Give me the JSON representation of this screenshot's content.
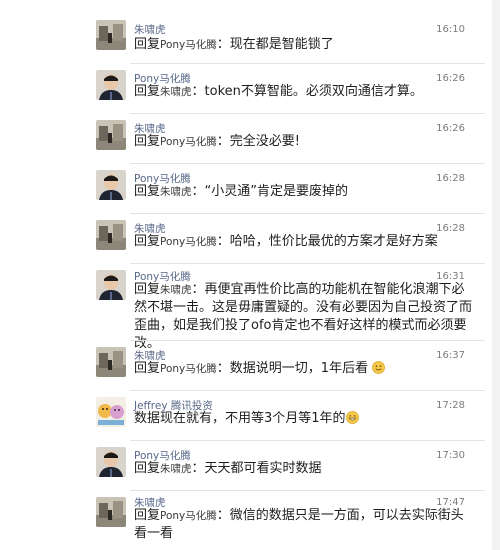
{
  "comments": [
    {
      "author": "朱啸虎",
      "time": "16:10",
      "reply_word": "回复",
      "reply_to": "Pony马化腾",
      "sep": "：",
      "text": "现在都是智能锁了",
      "avatar": "street-photo"
    },
    {
      "author": "Pony马化腾",
      "time": "16:26",
      "reply_word": "回复",
      "reply_to": "朱啸虎",
      "sep": "：",
      "text": "token不算智能。必须双向通信才算。",
      "avatar": "portrait-photo"
    },
    {
      "author": "朱啸虎",
      "time": "16:26",
      "reply_word": "回复",
      "reply_to": "Pony马化腾",
      "sep": "：",
      "text": "完全没必要!",
      "avatar": "street-photo"
    },
    {
      "author": "Pony马化腾",
      "time": "16:28",
      "reply_word": "回复",
      "reply_to": "朱啸虎",
      "sep": "：",
      "text": "“小灵通”肯定是要废掉的",
      "avatar": "portrait-photo"
    },
    {
      "author": "朱啸虎",
      "time": "16:28",
      "reply_word": "回复",
      "reply_to": "Pony马化腾",
      "sep": "：",
      "text": "哈哈，性价比最优的方案才是好方案",
      "avatar": "street-photo"
    },
    {
      "author": "Pony马化腾",
      "time": "16:31",
      "reply_word": "回复",
      "reply_to": "朱啸虎",
      "sep": "：",
      "text": "再便宜再性价比高的功能机在智能化浪潮下必然不堪一击。这是毋庸置疑的。没有必要因为自己投资了而歪曲，如是我们投了ofo肯定也不看好这样的模式而必须要改。",
      "avatar": "portrait-photo"
    },
    {
      "author": "朱啸虎",
      "time": "16:37",
      "reply_word": "回复",
      "reply_to": "Pony马化腾",
      "sep": "：",
      "text": "数据说明一切，1年后看",
      "emoji": "smile-emoji",
      "avatar": "street-photo"
    },
    {
      "author": "Jeffrey 腾讯投资",
      "time": "17:28",
      "reply_word": "",
      "reply_to": "",
      "sep": "",
      "text": "数据现在就有，不用等3个月等1年的",
      "emoji": "grin-emoji",
      "avatar": "cartoon-photo"
    },
    {
      "author": "Pony马化腾",
      "time": "17:30",
      "reply_word": "回复",
      "reply_to": "朱啸虎",
      "sep": "：",
      "text": "天天都可看实时数据",
      "avatar": "portrait-photo"
    },
    {
      "author": "朱啸虎",
      "time": "17:47",
      "reply_word": "回复",
      "reply_to": "Pony马化腾",
      "sep": "：",
      "text": "微信的数据只是一方面，可以去实际街头看一看",
      "avatar": "street-photo"
    }
  ]
}
